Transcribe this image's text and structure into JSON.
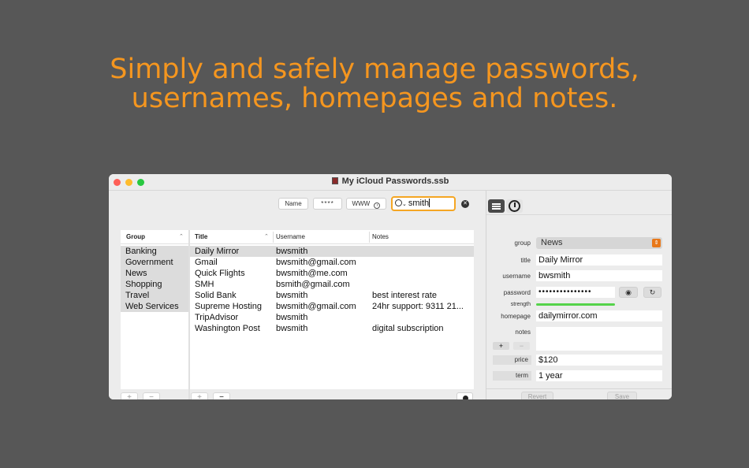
{
  "headline": {
    "line1": "Simply and safely manage passwords,",
    "line2": "usernames, homepages and notes."
  },
  "window": {
    "title": "My iCloud Passwords.ssb"
  },
  "toolbar": {
    "name_label": "Name",
    "password_label": "****",
    "www_label": "WWW",
    "www_icon": "arrow-circle-icon",
    "search_value": "smith",
    "search_icon": "magnifier-icon",
    "clear_icon": "x-circle-icon"
  },
  "groups": {
    "header": "Group",
    "items": [
      "Banking",
      "Government",
      "News",
      "Shopping",
      "Travel",
      "Web Services"
    ],
    "add_label": "+",
    "remove_label": "−"
  },
  "records": {
    "columns": {
      "title": "Title",
      "username": "Username",
      "notes": "Notes"
    },
    "rows": [
      {
        "title": "Daily Mirror",
        "username": "bwsmith",
        "notes": ""
      },
      {
        "title": "Gmail",
        "username": "bwsmith@gmail.com",
        "notes": ""
      },
      {
        "title": "Quick Flights",
        "username": "bwsmith@me.com",
        "notes": ""
      },
      {
        "title": "SMH",
        "username": "bsmith@gmail.com",
        "notes": ""
      },
      {
        "title": "Solid Bank",
        "username": "bwsmith",
        "notes": "best interest rate"
      },
      {
        "title": "Supreme Hosting",
        "username": "bwsmith@gmail.com",
        "notes": "24hr support: 9311 21..."
      },
      {
        "title": "TripAdvisor",
        "username": "bwsmith",
        "notes": ""
      },
      {
        "title": "Washington Post",
        "username": "bwsmith",
        "notes": "digital subscription"
      }
    ],
    "add_label": "+",
    "remove_label": "−"
  },
  "details": {
    "group_label": "group",
    "group_value": "News",
    "title_label": "title",
    "title_value": "Daily Mirror",
    "username_label": "username",
    "username_value": "bwsmith",
    "password_label": "password",
    "password_value": "•••••••••••••••",
    "strength_label": "strength",
    "homepage_label": "homepage",
    "homepage_value": "dailymirror.com",
    "notes_label": "notes",
    "notes_value": "",
    "custom_add_label": "+",
    "custom_remove_label": "−",
    "price_label": "price",
    "price_value": "$120",
    "term_label": "term",
    "term_value": "1 year",
    "revert_label": "Revert",
    "save_label": "Save"
  },
  "colors": {
    "headline": "#f5961f",
    "background": "#575757",
    "search_focus": "#f5a623",
    "strength": "#55d34a",
    "popup_accent": "#e8781a"
  }
}
